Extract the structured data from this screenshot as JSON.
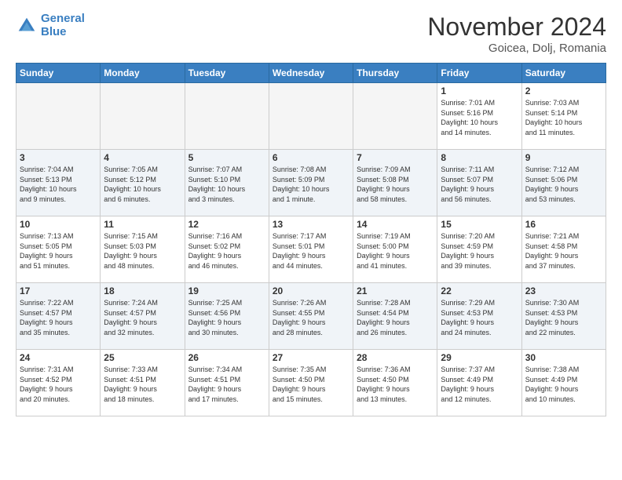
{
  "header": {
    "logo_line1": "General",
    "logo_line2": "Blue",
    "month": "November 2024",
    "location": "Goicea, Dolj, Romania"
  },
  "weekdays": [
    "Sunday",
    "Monday",
    "Tuesday",
    "Wednesday",
    "Thursday",
    "Friday",
    "Saturday"
  ],
  "weeks": [
    [
      {
        "day": "",
        "info": ""
      },
      {
        "day": "",
        "info": ""
      },
      {
        "day": "",
        "info": ""
      },
      {
        "day": "",
        "info": ""
      },
      {
        "day": "",
        "info": ""
      },
      {
        "day": "1",
        "info": "Sunrise: 7:01 AM\nSunset: 5:16 PM\nDaylight: 10 hours\nand 14 minutes."
      },
      {
        "day": "2",
        "info": "Sunrise: 7:03 AM\nSunset: 5:14 PM\nDaylight: 10 hours\nand 11 minutes."
      }
    ],
    [
      {
        "day": "3",
        "info": "Sunrise: 7:04 AM\nSunset: 5:13 PM\nDaylight: 10 hours\nand 9 minutes."
      },
      {
        "day": "4",
        "info": "Sunrise: 7:05 AM\nSunset: 5:12 PM\nDaylight: 10 hours\nand 6 minutes."
      },
      {
        "day": "5",
        "info": "Sunrise: 7:07 AM\nSunset: 5:10 PM\nDaylight: 10 hours\nand 3 minutes."
      },
      {
        "day": "6",
        "info": "Sunrise: 7:08 AM\nSunset: 5:09 PM\nDaylight: 10 hours\nand 1 minute."
      },
      {
        "day": "7",
        "info": "Sunrise: 7:09 AM\nSunset: 5:08 PM\nDaylight: 9 hours\nand 58 minutes."
      },
      {
        "day": "8",
        "info": "Sunrise: 7:11 AM\nSunset: 5:07 PM\nDaylight: 9 hours\nand 56 minutes."
      },
      {
        "day": "9",
        "info": "Sunrise: 7:12 AM\nSunset: 5:06 PM\nDaylight: 9 hours\nand 53 minutes."
      }
    ],
    [
      {
        "day": "10",
        "info": "Sunrise: 7:13 AM\nSunset: 5:05 PM\nDaylight: 9 hours\nand 51 minutes."
      },
      {
        "day": "11",
        "info": "Sunrise: 7:15 AM\nSunset: 5:03 PM\nDaylight: 9 hours\nand 48 minutes."
      },
      {
        "day": "12",
        "info": "Sunrise: 7:16 AM\nSunset: 5:02 PM\nDaylight: 9 hours\nand 46 minutes."
      },
      {
        "day": "13",
        "info": "Sunrise: 7:17 AM\nSunset: 5:01 PM\nDaylight: 9 hours\nand 44 minutes."
      },
      {
        "day": "14",
        "info": "Sunrise: 7:19 AM\nSunset: 5:00 PM\nDaylight: 9 hours\nand 41 minutes."
      },
      {
        "day": "15",
        "info": "Sunrise: 7:20 AM\nSunset: 4:59 PM\nDaylight: 9 hours\nand 39 minutes."
      },
      {
        "day": "16",
        "info": "Sunrise: 7:21 AM\nSunset: 4:58 PM\nDaylight: 9 hours\nand 37 minutes."
      }
    ],
    [
      {
        "day": "17",
        "info": "Sunrise: 7:22 AM\nSunset: 4:57 PM\nDaylight: 9 hours\nand 35 minutes."
      },
      {
        "day": "18",
        "info": "Sunrise: 7:24 AM\nSunset: 4:57 PM\nDaylight: 9 hours\nand 32 minutes."
      },
      {
        "day": "19",
        "info": "Sunrise: 7:25 AM\nSunset: 4:56 PM\nDaylight: 9 hours\nand 30 minutes."
      },
      {
        "day": "20",
        "info": "Sunrise: 7:26 AM\nSunset: 4:55 PM\nDaylight: 9 hours\nand 28 minutes."
      },
      {
        "day": "21",
        "info": "Sunrise: 7:28 AM\nSunset: 4:54 PM\nDaylight: 9 hours\nand 26 minutes."
      },
      {
        "day": "22",
        "info": "Sunrise: 7:29 AM\nSunset: 4:53 PM\nDaylight: 9 hours\nand 24 minutes."
      },
      {
        "day": "23",
        "info": "Sunrise: 7:30 AM\nSunset: 4:53 PM\nDaylight: 9 hours\nand 22 minutes."
      }
    ],
    [
      {
        "day": "24",
        "info": "Sunrise: 7:31 AM\nSunset: 4:52 PM\nDaylight: 9 hours\nand 20 minutes."
      },
      {
        "day": "25",
        "info": "Sunrise: 7:33 AM\nSunset: 4:51 PM\nDaylight: 9 hours\nand 18 minutes."
      },
      {
        "day": "26",
        "info": "Sunrise: 7:34 AM\nSunset: 4:51 PM\nDaylight: 9 hours\nand 17 minutes."
      },
      {
        "day": "27",
        "info": "Sunrise: 7:35 AM\nSunset: 4:50 PM\nDaylight: 9 hours\nand 15 minutes."
      },
      {
        "day": "28",
        "info": "Sunrise: 7:36 AM\nSunset: 4:50 PM\nDaylight: 9 hours\nand 13 minutes."
      },
      {
        "day": "29",
        "info": "Sunrise: 7:37 AM\nSunset: 4:49 PM\nDaylight: 9 hours\nand 12 minutes."
      },
      {
        "day": "30",
        "info": "Sunrise: 7:38 AM\nSunset: 4:49 PM\nDaylight: 9 hours\nand 10 minutes."
      }
    ]
  ]
}
